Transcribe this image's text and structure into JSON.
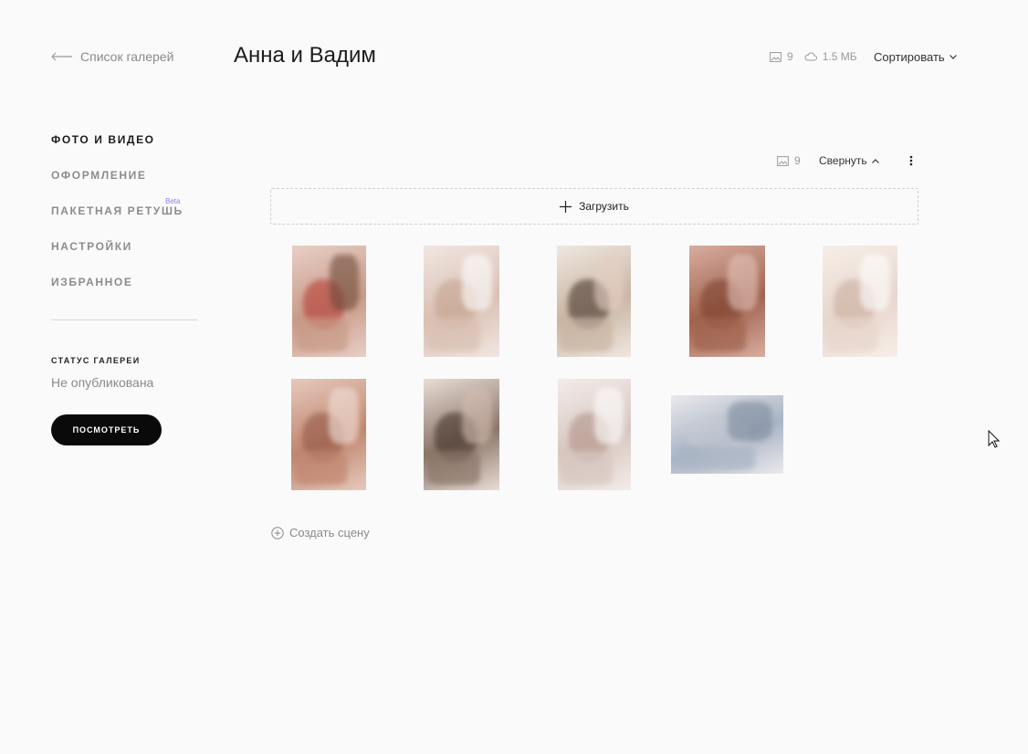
{
  "header": {
    "back_label": "Список галерей",
    "title": "Анна и Вадим",
    "photo_count": "9",
    "storage_size": "1.5 МБ",
    "sort_label": "Сортировать"
  },
  "sidebar": {
    "items": [
      {
        "label": "ФОТО И ВИДЕО",
        "active": true
      },
      {
        "label": "ОФОРМЛЕНИЕ",
        "active": false
      },
      {
        "label": "ПАКЕТНАЯ РЕТУШЬ",
        "active": false,
        "badge": "Beta"
      },
      {
        "label": "НАСТРОЙКИ",
        "active": false
      },
      {
        "label": "ИЗБРАННОЕ",
        "active": false
      }
    ],
    "status_title": "СТАТУС ГАЛЕРЕИ",
    "status_value": "Не опубликована",
    "view_button": "ПОСМОТРЕТЬ"
  },
  "section": {
    "photo_count": "9",
    "collapse_label": "Свернуть",
    "upload_label": "Загрузить",
    "create_scene_label": "Создать сцену"
  },
  "photos": [
    {
      "subject": "red shoes and rings",
      "colors": [
        "#c89a86",
        "#e8cfc7",
        "#b5342f",
        "#6e4b3a"
      ]
    },
    {
      "subject": "lace dress back",
      "colors": [
        "#d9c0b2",
        "#f1e6e2",
        "#c2a08c",
        "#ffffff"
      ]
    },
    {
      "subject": "bride smiling",
      "colors": [
        "#c9b5a3",
        "#efe7e0",
        "#3d2a22",
        "#e6cfc4"
      ]
    },
    {
      "subject": "mirror and shoes on floor",
      "colors": [
        "#a0634e",
        "#d8ada0",
        "#7c3f2e",
        "#e4c4bb"
      ]
    },
    {
      "subject": "bride at window",
      "colors": [
        "#e7d6cc",
        "#f7eee9",
        "#c7a99a",
        "#ffffff"
      ]
    },
    {
      "subject": "flowers and mirror",
      "colors": [
        "#c0866f",
        "#e6c9bc",
        "#8f5443",
        "#f2e2db"
      ]
    },
    {
      "subject": "bride in robe",
      "colors": [
        "#8b7568",
        "#e8ddd6",
        "#3c2c25",
        "#d3bcb0"
      ]
    },
    {
      "subject": "buttoning the dress",
      "colors": [
        "#d7c6bf",
        "#f3ecea",
        "#b08f84",
        "#ffffff"
      ]
    },
    {
      "subject": "shoes on patterned floor",
      "colors": [
        "#a9b4c4",
        "#eae9ec",
        "#c7cbd4",
        "#7d8a9d"
      ]
    }
  ],
  "colors": {
    "background": "#fafafa",
    "button_dark": "#0a0a0a",
    "beta_badge": "#8b7cf6",
    "muted_text": "#8a8a8a"
  }
}
